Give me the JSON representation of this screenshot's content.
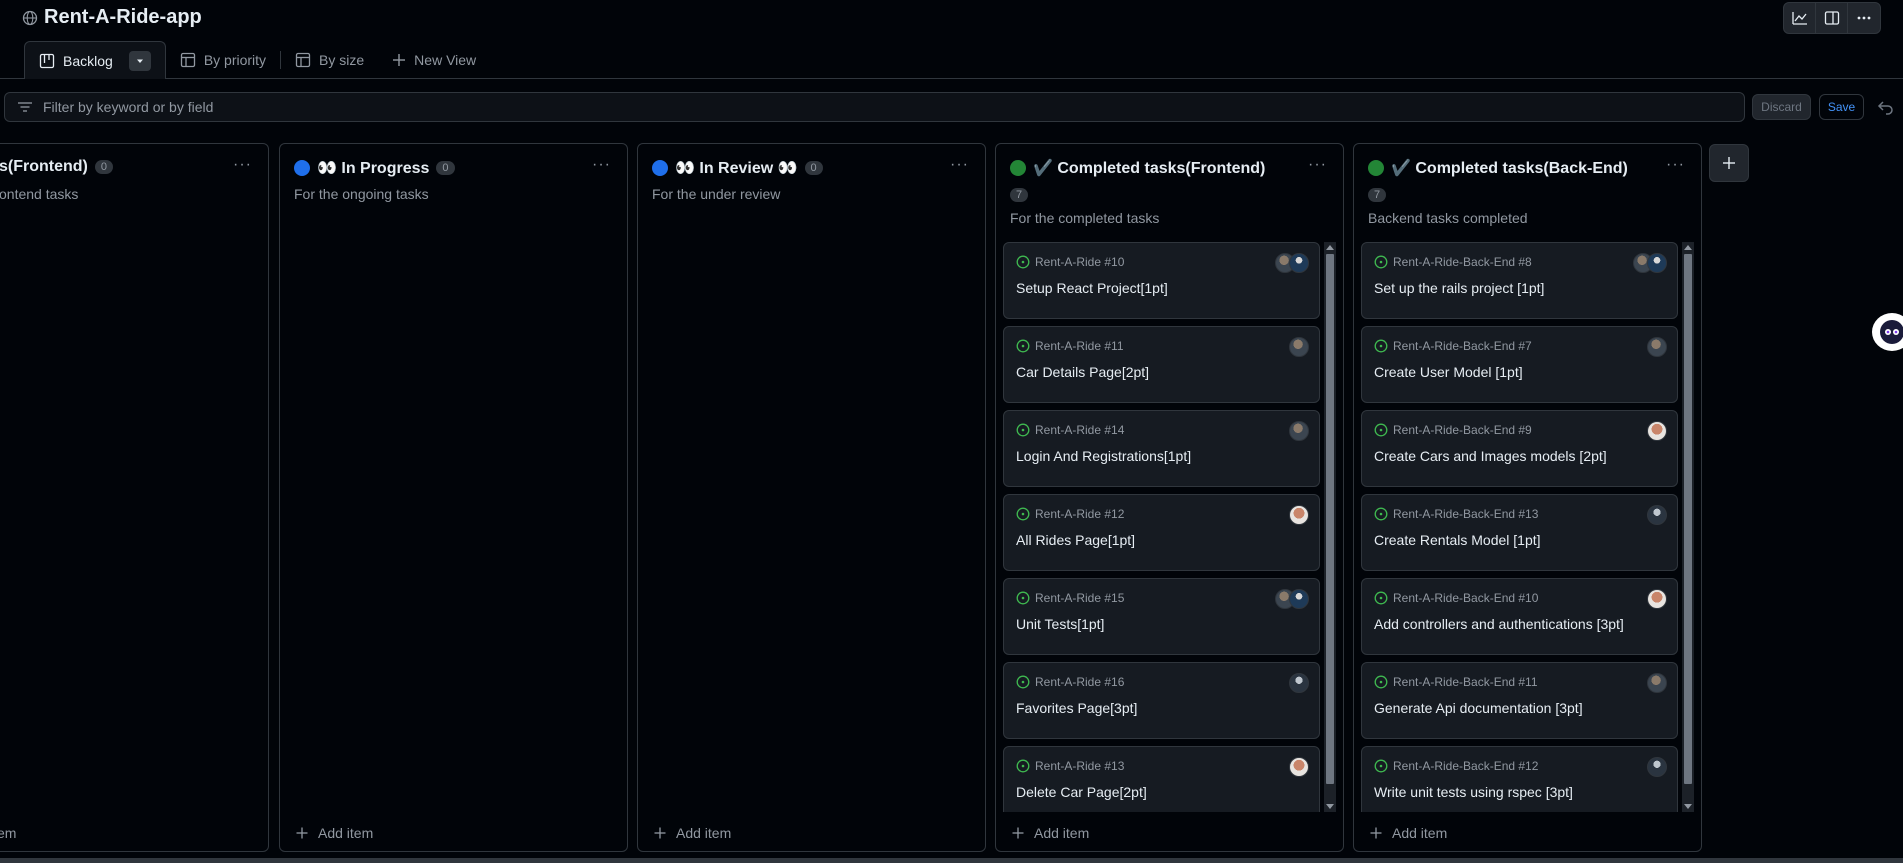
{
  "project": {
    "title": "Rent-A-Ride-app"
  },
  "tabs": [
    {
      "label": "Backlog",
      "icon": "board-icon",
      "active": true
    },
    {
      "label": "By priority",
      "icon": "table-icon"
    },
    {
      "label": "By size",
      "icon": "table-icon"
    },
    {
      "label": "New View",
      "icon": "plus-icon"
    }
  ],
  "filter": {
    "placeholder": "Filter by keyword or by field",
    "value": ""
  },
  "actions": {
    "discard": "Discard",
    "save": "Save"
  },
  "colors": {
    "blue": "#1f6feb",
    "green": "#238636",
    "issue_open": "#3fb950"
  },
  "columns": [
    {
      "title": "s(Frontend)",
      "count": "0",
      "description": "ontend tasks",
      "add": "em"
    },
    {
      "title": "👀 In Progress",
      "count": "0",
      "description": "For the ongoing tasks",
      "add": "Add item",
      "dot": "blue"
    },
    {
      "title": "👀 In Review 👀",
      "count": "0",
      "description": "For the under review",
      "add": "Add item",
      "dot": "blue"
    },
    {
      "title": "✔️ Completed tasks(Frontend)",
      "count": "7",
      "description": "For the completed tasks",
      "add": "Add item",
      "dot": "green",
      "cards": [
        {
          "ref": "Rent-A-Ride #10",
          "title": "Setup React Project[1pt]",
          "avatars": [
            "av1",
            "av2"
          ]
        },
        {
          "ref": "Rent-A-Ride #11",
          "title": "Car Details Page[2pt]",
          "avatars": [
            "av1"
          ]
        },
        {
          "ref": "Rent-A-Ride #14",
          "title": "Login And Registrations[1pt]",
          "avatars": [
            "av1"
          ]
        },
        {
          "ref": "Rent-A-Ride #12",
          "title": "All Rides Page[1pt]",
          "avatars": [
            "av3"
          ]
        },
        {
          "ref": "Rent-A-Ride #15",
          "title": "Unit Tests[1pt]",
          "avatars": [
            "av1",
            "av2"
          ]
        },
        {
          "ref": "Rent-A-Ride #16",
          "title": "Favorites Page[3pt]",
          "avatars": [
            "av4"
          ]
        },
        {
          "ref": "Rent-A-Ride #13",
          "title": "Delete Car Page[2pt]",
          "avatars": [
            "av3"
          ]
        }
      ]
    },
    {
      "title": "✔️ Completed tasks(Back-End)",
      "count": "7",
      "description": "Backend tasks completed",
      "add": "Add item",
      "dot": "green",
      "cards": [
        {
          "ref": "Rent-A-Ride-Back-End #8",
          "title": "Set up the rails project [1pt]",
          "avatars": [
            "av1",
            "av2"
          ]
        },
        {
          "ref": "Rent-A-Ride-Back-End #7",
          "title": "Create User Model [1pt]",
          "avatars": [
            "av1"
          ]
        },
        {
          "ref": "Rent-A-Ride-Back-End #9",
          "title": "Create Cars and Images models [2pt]",
          "avatars": [
            "av3"
          ]
        },
        {
          "ref": "Rent-A-Ride-Back-End #13",
          "title": "Create Rentals Model [1pt]",
          "avatars": [
            "av4"
          ]
        },
        {
          "ref": "Rent-A-Ride-Back-End #10",
          "title": "Add controllers and authentications [3pt]",
          "avatars": [
            "av3"
          ]
        },
        {
          "ref": "Rent-A-Ride-Back-End #11",
          "title": "Generate Api documentation [3pt]",
          "avatars": [
            "av1"
          ]
        },
        {
          "ref": "Rent-A-Ride-Back-End #12",
          "title": "Write unit tests using rspec [3pt]",
          "avatars": [
            "av4"
          ]
        }
      ]
    }
  ]
}
